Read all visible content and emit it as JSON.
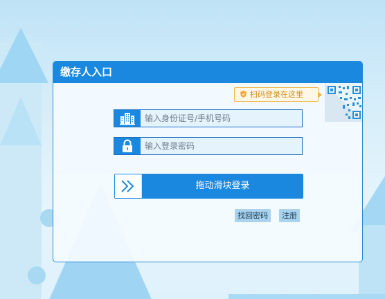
{
  "login": {
    "title": "缴存人入口",
    "scan_tip": "扫码登录在这里",
    "id_field_placeholder": "输入身份证号/手机号码",
    "password_placeholder": "输入登录密码",
    "slider_label": "拖动滑块登录",
    "forgot_password": "找回密码",
    "register": "注册"
  },
  "colors": {
    "primary": "#1b88e0",
    "tip_border": "#f0b64b",
    "tip_text": "#d58b1a"
  },
  "icons": {
    "id_field": "building-icon",
    "password_field": "lock-icon",
    "slider": "double-chevron-right-icon",
    "scan_tip": "shield-icon",
    "qr": "qr-code-icon"
  }
}
